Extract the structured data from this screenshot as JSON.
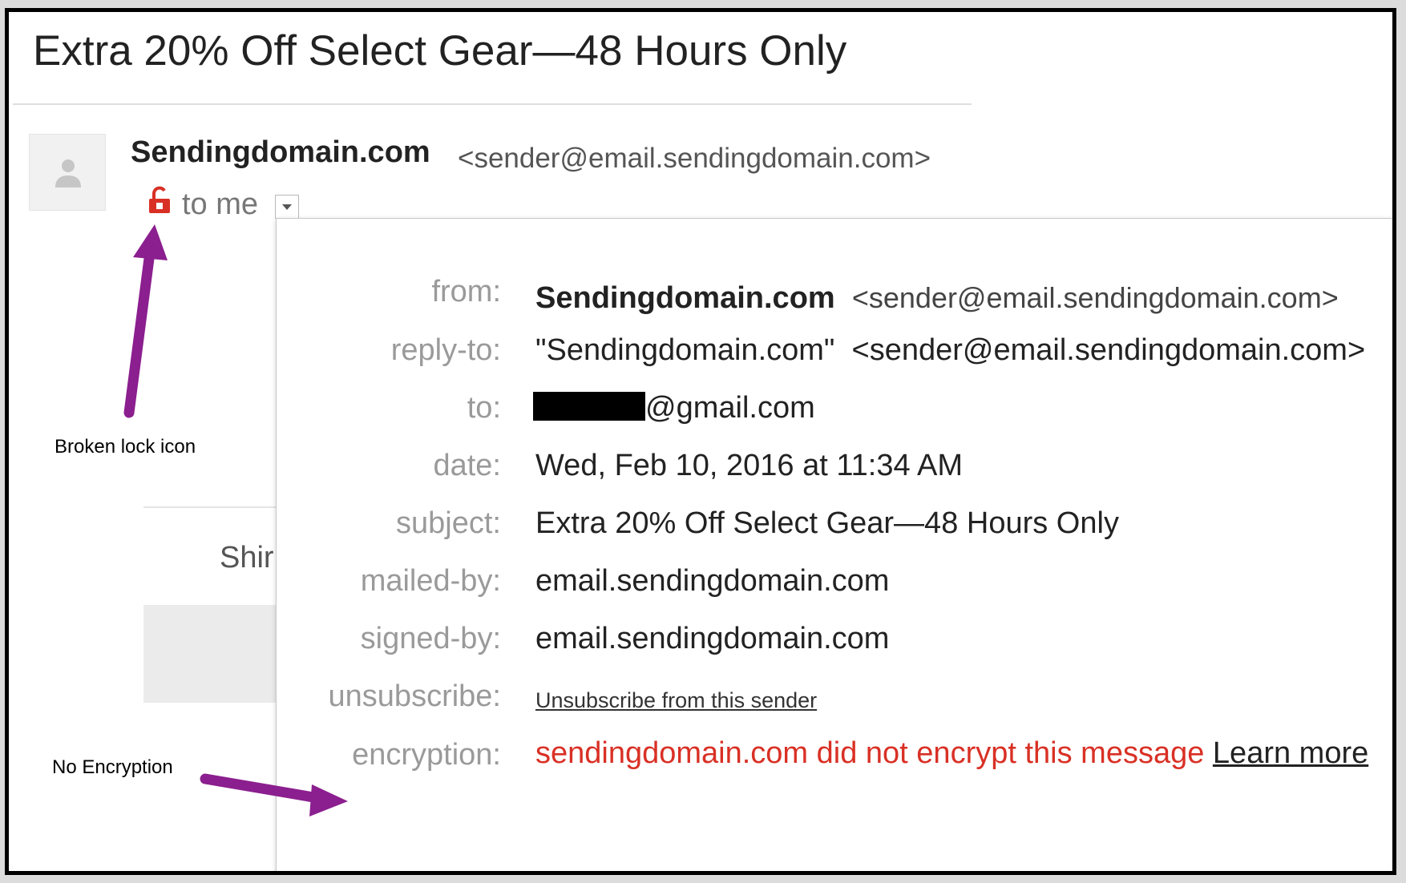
{
  "email": {
    "subject": "Extra 20% Off Select Gear—48 Hours Only",
    "sender_name": "Sendingdomain.com",
    "sender_email": "<sender@email.sendingdomain.com>",
    "recipient_summary": "to me",
    "background_fragment": "Shir"
  },
  "details": {
    "from_label": "from:",
    "from_name": "Sendingdomain.com",
    "from_email": "<sender@email.sendingdomain.com>",
    "reply_to_label": "reply-to:",
    "reply_to_value": "\"Sendingdomain.com\"  <sender@email.sendingdomain.com>",
    "to_label": "to:",
    "to_value": "@gmail.com",
    "date_label": "date:",
    "date_value": "Wed, Feb 10, 2016 at 11:34 AM",
    "subject_label": "subject:",
    "subject_value": "Extra 20% Off Select Gear—48 Hours Only",
    "mailed_by_label": "mailed-by:",
    "mailed_by_value": "email.sendingdomain.com",
    "signed_by_label": "signed-by:",
    "signed_by_value": "email.sendingdomain.com",
    "unsubscribe_label": "unsubscribe:",
    "unsubscribe_link": "Unsubscribe from this sender",
    "encryption_label": "encryption:",
    "encryption_value": "sendingdomain.com did not encrypt this message",
    "learn_more": "Learn more"
  },
  "annotations": {
    "lock": "Broken lock icon",
    "encryption": "No Encryption"
  },
  "colors": {
    "lock_icon": "#d93025",
    "arrow": "#8b1f8f",
    "encryption_text": "#d93025"
  },
  "icons": {
    "lock": "broken-lock-icon",
    "avatar": "person-icon",
    "toggle": "chevron-down-icon"
  }
}
